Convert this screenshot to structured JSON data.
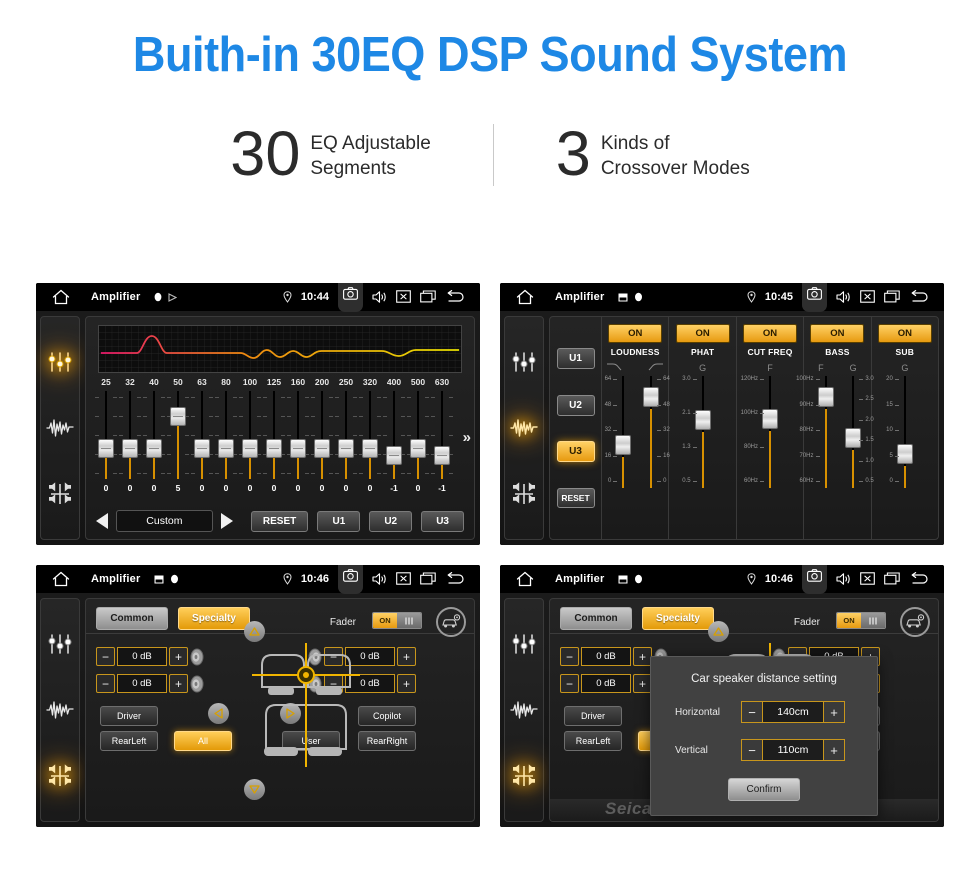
{
  "header": {
    "title": "Buith-in 30EQ DSP Sound System",
    "stats": [
      {
        "number": "30",
        "line1": "EQ Adjustable",
        "line2": "Segments"
      },
      {
        "number": "3",
        "line1": "Kinds of",
        "line2": "Crossover Modes"
      }
    ],
    "title_color": "#1E88E5"
  },
  "statusbar": {
    "app_title": "Amplifier",
    "times": [
      "10:44",
      "10:45",
      "10:46",
      "10:46"
    ],
    "icons": [
      "home-icon",
      "bluetooth-icon",
      "play-icon",
      "location-pin-icon",
      "camera-icon",
      "volume-icon",
      "close-icon",
      "recents-icon",
      "back-icon"
    ]
  },
  "sidebar": {
    "items": [
      {
        "name": "equalizer-icon",
        "label": "Equalizer"
      },
      {
        "name": "waveform-icon",
        "label": "Sound Effect"
      },
      {
        "name": "balance-icon",
        "label": "Balance"
      }
    ]
  },
  "panel_eq": {
    "frequencies": [
      "25",
      "32",
      "40",
      "50",
      "63",
      "80",
      "100",
      "125",
      "160",
      "200",
      "250",
      "320",
      "400",
      "500",
      "630"
    ],
    "values": [
      "0",
      "0",
      "0",
      "5",
      "0",
      "0",
      "0",
      "0",
      "0",
      "0",
      "0",
      "0",
      "-1",
      "0",
      "-1"
    ],
    "preset_label": "Custom",
    "prev_icon": "triangle-left-icon",
    "next_icon": "triangle-right-icon",
    "reset_label": "RESET",
    "user_presets": [
      "U1",
      "U2",
      "U3"
    ],
    "more_icon": "chevron-right-double-icon",
    "curve_colors": [
      "#e8186b",
      "#f08a10",
      "#e8e000"
    ],
    "active_sidebar_index": 0
  },
  "panel_dsp": {
    "presets": [
      "U1",
      "U2",
      "U3"
    ],
    "active_preset": "U3",
    "reset_label": "RESET",
    "active_sidebar_index": 1,
    "columns": [
      {
        "name": "LOUDNESS",
        "state": "ON",
        "sub": [
          "curve-down-icon",
          "curve-up-icon"
        ],
        "sliders": [
          {
            "scale": [
              "64",
              "48",
              "32",
              "16",
              "0"
            ],
            "pos": 0.34,
            "side": "left"
          },
          {
            "scale": [
              "64",
              "48",
              "32",
              "16",
              "0"
            ],
            "pos": 0.88,
            "side": "right"
          }
        ]
      },
      {
        "name": "PHAT",
        "state": "ON",
        "sub": [
          "G"
        ],
        "sliders": [
          {
            "scale": [
              "3.0",
              "2.1",
              "1.3",
              "0.5"
            ],
            "pos": 0.62,
            "side": "center"
          }
        ]
      },
      {
        "name": "CUT FREQ",
        "state": "ON",
        "sub": [
          "F"
        ],
        "sliders": [
          {
            "scale": [
              "120Hz",
              "100Hz",
              "80Hz",
              "60Hz"
            ],
            "pos": 0.63,
            "side": "center"
          }
        ]
      },
      {
        "name": "BASS",
        "state": "ON",
        "sub": [
          "F",
          "G"
        ],
        "sliders": [
          {
            "scale": [
              "100Hz",
              "90Hz",
              "80Hz",
              "70Hz",
              "60Hz"
            ],
            "pos": 0.88,
            "side": "left"
          },
          {
            "scale": [
              "3.0",
              "2.5",
              "2.0",
              "1.5",
              "1.0",
              "0.5"
            ],
            "pos": 0.42,
            "side": "right"
          }
        ]
      },
      {
        "name": "SUB",
        "state": "ON",
        "sub": [
          "G"
        ],
        "sliders": [
          {
            "scale": [
              "20",
              "15",
              "10",
              "5",
              "0"
            ],
            "pos": 0.25,
            "side": "center"
          }
        ]
      }
    ]
  },
  "panel_fader": {
    "tabs": [
      {
        "label": "Common",
        "active": false
      },
      {
        "label": "Specialty",
        "active": true
      }
    ],
    "fader_label": "Fader",
    "fader_state": "ON",
    "car_settings_icon": "car-settings-icon",
    "steppers": [
      {
        "position": "front-left",
        "value": "0 dB",
        "minus": "−",
        "plus": "+"
      },
      {
        "position": "front-right",
        "value": "0 dB",
        "minus": "−",
        "plus": "+"
      },
      {
        "position": "rear-left",
        "value": "0 dB",
        "minus": "−",
        "plus": "+"
      },
      {
        "position": "rear-right",
        "value": "0 dB",
        "minus": "−",
        "plus": "+"
      }
    ],
    "seat_buttons": [
      {
        "label": "Driver",
        "active": false
      },
      {
        "label": "Copilot",
        "active": false
      },
      {
        "label": "RearLeft",
        "active": false
      },
      {
        "label": "All",
        "active": true
      },
      {
        "label": "User",
        "active": false
      },
      {
        "label": "RearRight",
        "active": false
      }
    ],
    "arrows": [
      "arrow-up-icon",
      "arrow-down-icon",
      "arrow-left-icon",
      "arrow-right-icon"
    ],
    "active_sidebar_index": 2
  },
  "panel_dialog": {
    "title": "Car speaker distance setting",
    "rows": [
      {
        "label": "Horizontal",
        "value": "140cm",
        "minus": "−",
        "plus": "+"
      },
      {
        "label": "Vertical",
        "value": "110cm",
        "minus": "−",
        "plus": "+"
      }
    ],
    "confirm_label": "Confirm",
    "watermark": "Seicane"
  }
}
